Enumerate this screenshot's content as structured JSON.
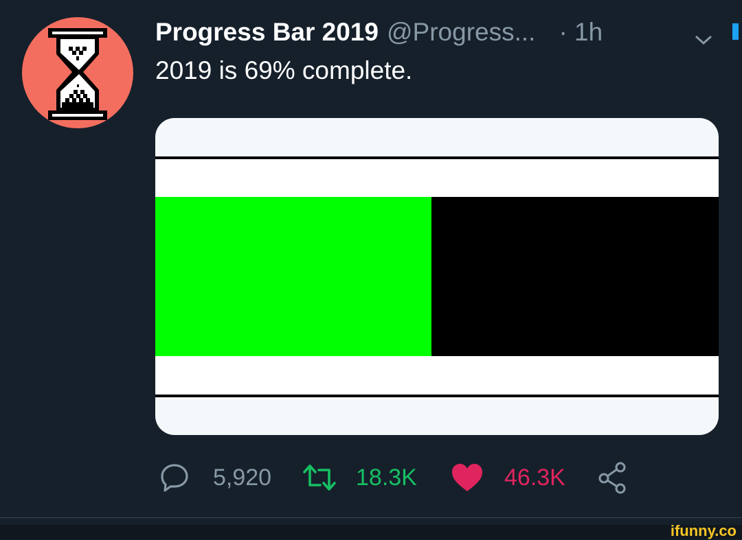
{
  "tweet": {
    "display_name": "Progress Bar 2019",
    "handle": "@Progress...",
    "time": "· 1h",
    "text": "2019 is 69% complete."
  },
  "avatar": {
    "icon": "hourglass-icon",
    "background": "#f46e5f"
  },
  "media": {
    "progress_fraction": 0.49,
    "fill_color": "#00ff00",
    "track_color": "#000000"
  },
  "actions": {
    "reply": {
      "icon": "reply-icon",
      "count": "5,920"
    },
    "retweet": {
      "icon": "retweet-icon",
      "count": "18.3K",
      "color": "#17bf63"
    },
    "like": {
      "icon": "heart-icon",
      "count": "46.3K",
      "color": "#e0245e"
    },
    "share": {
      "icon": "share-icon"
    }
  },
  "watermark": "ifunny.co",
  "colors": {
    "background": "#15202b",
    "secondary_text": "#8899a6",
    "accent_blue": "#1da1f2"
  }
}
